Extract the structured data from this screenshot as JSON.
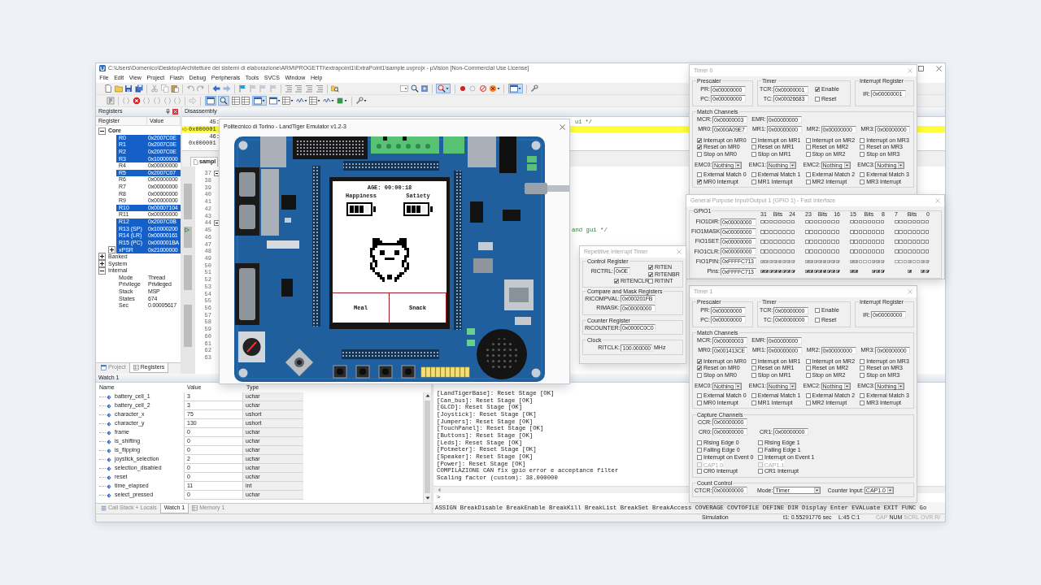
{
  "main_window": {
    "title": "C:\\Users\\Domenico\\Desktop\\Architetture dei sistemi di elaborazione\\ARM\\PROGETTI\\extrapoint1\\ExtraPoint1\\sample.uvprojx - µVision [Non-Commercial Use License]",
    "menu": [
      "File",
      "Edit",
      "View",
      "Project",
      "Flash",
      "Debug",
      "Peripherals",
      "Tools",
      "SVCS",
      "Window",
      "Help"
    ],
    "registers_panel": {
      "title": "Registers",
      "columns": [
        "Register",
        "Value"
      ],
      "tree": [
        {
          "name": "Core",
          "emphasized": true,
          "expanded": true,
          "children": [
            {
              "kind": "register",
              "name": "R0",
              "value": "0x2007C0E",
              "highlighted": true
            },
            {
              "kind": "register",
              "name": "R1",
              "value": "0x2007C0E",
              "highlighted": true
            },
            {
              "kind": "register",
              "name": "R2",
              "value": "0x2007C0E",
              "highlighted": true
            },
            {
              "kind": "register",
              "name": "R3",
              "value": "0x10000000",
              "highlighted": true
            },
            {
              "kind": "register",
              "name": "R4",
              "value": "0x00000000",
              "highlighted": false
            },
            {
              "kind": "register",
              "name": "R5",
              "value": "0x2007C07",
              "highlighted": true
            },
            {
              "kind": "register",
              "name": "R6",
              "value": "0x00000000",
              "highlighted": false
            },
            {
              "kind": "register",
              "name": "R7",
              "value": "0x00000000",
              "highlighted": false
            },
            {
              "kind": "register",
              "name": "R8",
              "value": "0x00000000",
              "highlighted": false
            },
            {
              "kind": "register",
              "name": "R9",
              "value": "0x00000000",
              "highlighted": false
            },
            {
              "kind": "register",
              "name": "R10",
              "value": "0x00007104",
              "highlighted": true
            },
            {
              "kind": "register",
              "name": "R11",
              "value": "0x00000000",
              "highlighted": false
            },
            {
              "kind": "register",
              "name": "R12",
              "value": "0x2007C0B",
              "highlighted": true
            },
            {
              "kind": "register",
              "name": "R13 (SP)",
              "value": "0x10000200",
              "highlighted": true
            },
            {
              "kind": "register",
              "name": "R14 (LR)",
              "value": "0x00000161",
              "highlighted": true
            },
            {
              "kind": "register",
              "name": "R15 (PC)",
              "value": "0x000001BA",
              "highlighted": true
            },
            {
              "kind": "group",
              "name": "xPSR",
              "value": "0x21000000",
              "highlighted": true,
              "expanded": false
            }
          ]
        },
        {
          "name": "Banked",
          "emphasized": false,
          "expanded": false
        },
        {
          "name": "System",
          "emphasized": false,
          "expanded": false
        },
        {
          "name": "Internal",
          "emphasized": false,
          "expanded": true,
          "children": [
            {
              "kind": "register",
              "name": "Mode",
              "value": "Thread",
              "highlighted": false
            },
            {
              "kind": "register",
              "name": "Privilege",
              "value": "Privileged",
              "highlighted": false
            },
            {
              "kind": "register",
              "name": "Stack",
              "value": "MSP",
              "highlighted": false
            },
            {
              "kind": "register",
              "name": "States",
              "value": "674",
              "highlighted": false
            },
            {
              "kind": "register",
              "name": "Sec",
              "value": "0.00005617",
              "highlighted": false
            }
          ]
        }
      ],
      "tabs": [
        {
          "label": "Project",
          "selected": false
        },
        {
          "label": "Registers",
          "selected": true
        }
      ]
    },
    "disassembly": {
      "title": "Disassembly",
      "lines": [
        {
          "kind": "source",
          "text": "45:",
          "tail": "ui */",
          "current": false
        },
        {
          "kind": "address",
          "text": "0x000001",
          "current": true
        },
        {
          "kind": "source",
          "text": "46:",
          "current": false
        },
        {
          "kind": "address",
          "text": "0x000001",
          "current": false
        }
      ]
    },
    "editor": {
      "tab": "sampl",
      "lines": [
        {
          "number": "37",
          "executable": false,
          "fold_marker": true,
          "current": false
        },
        {
          "number": "38",
          "executable": false,
          "fold_marker": false,
          "current": false
        },
        {
          "number": "39",
          "executable": true,
          "fold_marker": false,
          "current": false
        },
        {
          "number": "40",
          "executable": true,
          "fold_marker": false,
          "current": false
        },
        {
          "number": "41",
          "executable": true,
          "fold_marker": false,
          "current": false
        },
        {
          "number": "42",
          "executable": true,
          "fold_marker": false,
          "current": false
        },
        {
          "number": "43",
          "executable": true,
          "fold_marker": false,
          "current": false
        },
        {
          "number": "44",
          "executable": false,
          "fold_marker": true,
          "current": false
        },
        {
          "number": "45",
          "executable": true,
          "fold_marker": false,
          "current": true,
          "text": "and gui */"
        },
        {
          "number": "46",
          "executable": true,
          "fold_marker": false,
          "current": false
        },
        {
          "number": "47",
          "executable": true,
          "fold_marker": false,
          "current": false
        },
        {
          "number": "48",
          "executable": false,
          "fold_marker": false,
          "current": false
        },
        {
          "number": "49",
          "executable": true,
          "fold_marker": false,
          "current": false
        },
        {
          "number": "50",
          "executable": true,
          "fold_marker": false,
          "current": false
        },
        {
          "number": "51",
          "executable": true,
          "fold_marker": false,
          "current": false
        },
        {
          "number": "52",
          "executable": true,
          "fold_marker": false,
          "current": false
        },
        {
          "number": "53",
          "executable": true,
          "fold_marker": false,
          "current": false
        },
        {
          "number": "54",
          "executable": false,
          "fold_marker": false,
          "current": false
        },
        {
          "number": "55",
          "executable": false,
          "fold_marker": false,
          "current": false
        },
        {
          "number": "56",
          "executable": true,
          "fold_marker": false,
          "current": false
        },
        {
          "number": "57",
          "executable": true,
          "fold_marker": false,
          "current": false
        },
        {
          "number": "58",
          "executable": true,
          "fold_marker": false,
          "current": false
        },
        {
          "number": "59",
          "executable": true,
          "fold_marker": false,
          "current": false
        },
        {
          "number": "60",
          "executable": true,
          "fold_marker": false,
          "current": false
        },
        {
          "number": "61",
          "executable": true,
          "fold_marker": false,
          "current": false
        },
        {
          "number": "62",
          "executable": false,
          "fold_marker": false,
          "current": false
        },
        {
          "number": "63",
          "executable": false,
          "fold_marker": false,
          "current": false
        }
      ]
    },
    "watch_panel": {
      "title": "Watch 1",
      "columns": [
        "Name",
        "Value",
        "Type"
      ],
      "rows": [
        {
          "name": "battery_cell_1",
          "value": "3",
          "type": "uchar"
        },
        {
          "name": "battery_cell_2",
          "value": "3",
          "type": "uchar"
        },
        {
          "name": "character_x",
          "value": "75",
          "type": "ushort"
        },
        {
          "name": "character_y",
          "value": "130",
          "type": "ushort"
        },
        {
          "name": "frame",
          "value": "0",
          "type": "uchar"
        },
        {
          "name": "is_shifting",
          "value": "0",
          "type": "uchar"
        },
        {
          "name": "is_flipping",
          "value": "0",
          "type": "uchar"
        },
        {
          "name": "joystick_selection",
          "value": "2",
          "type": "uchar"
        },
        {
          "name": "selection_disabled",
          "value": "0",
          "type": "uchar"
        },
        {
          "name": "reset",
          "value": "0",
          "type": "uchar"
        },
        {
          "name": "time_elapsed",
          "value": "11",
          "type": "int"
        },
        {
          "name": "select_pressed",
          "value": "0",
          "type": "uchar"
        }
      ],
      "tabs": [
        {
          "label": "Call Stack + Locals",
          "selected": false
        },
        {
          "label": "Watch 1",
          "selected": true
        },
        {
          "label": "Memory 1",
          "selected": false
        }
      ]
    },
    "command_panel": {
      "lines": [
        "[LandTigerBase]: Reset Stage [OK]",
        "[Can_bus]: Reset Stage [OK]",
        "[GLCD]: Reset Stage [OK]",
        "[Joystick]: Reset Stage [OK]",
        "[Jumpers]: Reset Stage [OK]",
        "[TouchPanel]: Reset Stage [OK]",
        "[Buttons]: Reset Stage [OK]",
        "[Leds]: Reset Stage [OK]",
        "[Potmeter]: Reset Stage [OK]",
        "[Speaker]: Reset Stage [OK]",
        "[Power]: Reset Stage [OK]",
        "COMPILAZIONE CAN fix gpio error e acceptance filter",
        "Scaling factor (custom): 38.000000"
      ],
      "prompt": ">",
      "help": "ASSIGN BreakDisable BreakEnable BreakKill BreakList BreakSet BreakAccess COVERAGE COVTOFILE DEFINE DIR Display Enter EVALuate EXIT FUNC Go"
    },
    "status_bar": {
      "mode": "Simulation",
      "time": "t1: 0.55291776 sec",
      "position": "L:45 C:1",
      "indicators": [
        {
          "label": "CAP",
          "on": false
        },
        {
          "label": "NUM",
          "on": true
        },
        {
          "label": "SCRL",
          "on": false
        },
        {
          "label": "OVR",
          "on": false
        },
        {
          "label": "R/",
          "on": false
        }
      ]
    }
  },
  "emulator_window": {
    "title": "Politecnico di Torino - LandTiger Emulator v1.2-3",
    "active": true,
    "lcd": {
      "age": "AGE: 00:00:18",
      "meters": [
        {
          "label": "Happiness",
          "level": 0.75
        },
        {
          "label": "Satiety",
          "level": 0.75
        }
      ],
      "buttons": [
        "Meal",
        "Snack"
      ]
    }
  },
  "rit_window": {
    "title": "Repetitive Interrupt Timer",
    "active": false,
    "control": {
      "label": "Control Register",
      "field": {
        "label": "RICTRL:",
        "value": "0x0E"
      },
      "checks": [
        {
          "label": "RITEN",
          "checked": true
        },
        {
          "label": "RITENBR",
          "checked": true
        },
        {
          "label": "RITENCLR",
          "checked": true
        },
        {
          "label": "RITINT",
          "checked": false
        }
      ]
    },
    "groups": [
      {
        "label": "Compare and Mask Registers",
        "fields": [
          {
            "label": "RICOMPVAL:",
            "value": "0x000201FB"
          },
          {
            "label": "RIMASK:",
            "value": "0x00000000"
          }
        ]
      },
      {
        "label": "Counter Register",
        "fields": [
          {
            "label": "RICOUNTER:",
            "value": "0x0000C0C0"
          }
        ]
      },
      {
        "label": "Clock",
        "fields": [
          {
            "label": "RITCLK:",
            "value": "100.000000",
            "unit": "MHz"
          }
        ]
      }
    ]
  },
  "timer_0_window": {
    "title": "Timer 0",
    "active": false,
    "prescaler": {
      "label": "Prescaler",
      "fields": [
        {
          "label": "PR:",
          "value": "0x00000000"
        },
        {
          "label": "PC:",
          "value": "0x00000000"
        }
      ]
    },
    "timer": {
      "label": "Timer",
      "fields": [
        {
          "label": "TCR:",
          "value": "0x00000001",
          "option": {
            "label": "Enable",
            "checked": true
          }
        },
        {
          "label": "TC:",
          "value": "0x00026683",
          "option": {
            "label": "Reset",
            "checked": false
          }
        }
      ]
    },
    "interrupt": {
      "label": "Interrupt Register",
      "fields": [
        {
          "label": "IR:",
          "value": "0x00000001"
        }
      ]
    },
    "match": {
      "label": "Match Channels",
      "fields": [
        {
          "label": "MCR:",
          "value": "0x00000003"
        },
        {
          "label": "EMR:",
          "value": "0x00000000"
        }
      ],
      "channels": [
        {
          "register": {
            "label": "MR0:",
            "value": "0x000A09E7"
          },
          "options": [
            {
              "label": "Interrupt on MR0",
              "checked": true
            },
            {
              "label": "Reset on MR0",
              "checked": true
            },
            {
              "label": "Stop on MR0",
              "checked": false
            }
          ],
          "emc": {
            "label": "EMC0:",
            "value": "Nothing"
          },
          "outputs": [
            {
              "label": "External Match 0",
              "checked": false
            },
            {
              "label": "MR0 Interrupt",
              "checked": true
            }
          ]
        },
        {
          "register": {
            "label": "MR1:",
            "value": "0x00000000"
          },
          "options": [
            {
              "label": "Interrupt on MR1",
              "checked": false
            },
            {
              "label": "Reset on MR1",
              "checked": false
            },
            {
              "label": "Stop on MR1",
              "checked": false
            }
          ],
          "emc": {
            "label": "EMC1:",
            "value": "Nothing"
          },
          "outputs": [
            {
              "label": "External Match 1",
              "checked": false
            },
            {
              "label": "MR1 Interrupt",
              "checked": false
            }
          ]
        },
        {
          "register": {
            "label": "MR2:",
            "value": "0x00000000"
          },
          "options": [
            {
              "label": "Interrupt on MR2",
              "checked": false
            },
            {
              "label": "Reset on MR2",
              "checked": false
            },
            {
              "label": "Stop on MR2",
              "checked": false
            }
          ],
          "emc": {
            "label": "EMC2:",
            "value": "Nothing"
          },
          "outputs": [
            {
              "label": "External Match 2",
              "checked": false
            },
            {
              "label": "MR2 Interrupt",
              "checked": false
            }
          ]
        },
        {
          "register": {
            "label": "MR3:",
            "value": "0x00000000"
          },
          "options": [
            {
              "label": "Interrupt on MR3",
              "checked": false
            },
            {
              "label": "Reset on MR3",
              "checked": false
            },
            {
              "label": "Stop on MR3",
              "checked": false
            }
          ],
          "emc": {
            "label": "EMC3:",
            "value": "Nothing"
          },
          "outputs": [
            {
              "label": "External Match 3",
              "checked": false
            },
            {
              "label": "MR3 Interrupt",
              "checked": false
            }
          ]
        }
      ]
    }
  },
  "gpio_window": {
    "title": "General Purpose Input/Output 1 (GPIO 1) - Fast Interface",
    "active": false,
    "group": "GPIO1",
    "bit_groups": [
      {
        "high": "31",
        "label": "Bits",
        "low": "24"
      },
      {
        "high": "23",
        "label": "Bits",
        "low": "16"
      },
      {
        "high": "15",
        "label": "Bits",
        "low": "8"
      },
      {
        "high": "7",
        "label": "Bits",
        "low": "0"
      }
    ],
    "rows": [
      {
        "kind": "register",
        "label": "FIO1DIR:",
        "value": "0x00000000",
        "bits": [
          false,
          false,
          false,
          false,
          false,
          false,
          false,
          false,
          false,
          false,
          false,
          false,
          false,
          false,
          false,
          false,
          false,
          false,
          false,
          false,
          false,
          false,
          false,
          false,
          false,
          false,
          false,
          false,
          false,
          false,
          false,
          false
        ]
      },
      {
        "kind": "register",
        "label": "FIO1MASK:",
        "value": "0x00000000",
        "bits": [
          false,
          false,
          false,
          false,
          false,
          false,
          false,
          false,
          false,
          false,
          false,
          false,
          false,
          false,
          false,
          false,
          false,
          false,
          false,
          false,
          false,
          false,
          false,
          false,
          false,
          false,
          false,
          false,
          false,
          false,
          false,
          false
        ]
      },
      {
        "kind": "register",
        "label": "FIO1SET:",
        "value": "0x00000000",
        "bits": [
          false,
          false,
          false,
          false,
          false,
          false,
          false,
          false,
          false,
          false,
          false,
          false,
          false,
          false,
          false,
          false,
          false,
          false,
          false,
          false,
          false,
          false,
          false,
          false,
          false,
          false,
          false,
          false,
          false,
          false,
          false,
          false
        ]
      },
      {
        "kind": "register",
        "label": "FIO1CLR:",
        "value": "0x00000000",
        "bits": [
          false,
          false,
          false,
          false,
          false,
          false,
          false,
          false,
          false,
          false,
          false,
          false,
          false,
          false,
          false,
          false,
          false,
          false,
          false,
          false,
          false,
          false,
          false,
          false,
          false,
          false,
          false,
          false,
          false,
          false,
          false,
          false
        ]
      },
      {
        "kind": "readonly",
        "label": "FIO1PIN:",
        "value": "0xFFFFC713",
        "bits": [
          true,
          true,
          true,
          true,
          true,
          true,
          true,
          true,
          true,
          true,
          true,
          true,
          true,
          true,
          true,
          true,
          true,
          true,
          false,
          false,
          false,
          true,
          true,
          true,
          false,
          false,
          false,
          true,
          false,
          false,
          true,
          true
        ]
      },
      {
        "kind": "pins",
        "label": "Pins:",
        "value": "0xFFFFC713",
        "bits": [
          true,
          true,
          true,
          true,
          true,
          true,
          true,
          true,
          true,
          true,
          true,
          true,
          true,
          true,
          true,
          true,
          true,
          true,
          false,
          false,
          false,
          true,
          true,
          true,
          false,
          false,
          false,
          true,
          false,
          false,
          true,
          true
        ]
      }
    ]
  },
  "timer_1_window": {
    "title": "Timer 1",
    "active": false,
    "prescaler": {
      "label": "Prescaler",
      "fields": [
        {
          "label": "PR:",
          "value": "0x00000000"
        },
        {
          "label": "PC:",
          "value": "0x00000000"
        }
      ]
    },
    "timer": {
      "label": "Timer",
      "fields": [
        {
          "label": "TCR:",
          "value": "0x00000000",
          "option": {
            "label": "Enable",
            "checked": false
          }
        },
        {
          "label": "TC:",
          "value": "0x00000000",
          "option": {
            "label": "Reset",
            "checked": false
          }
        }
      ]
    },
    "interrupt": {
      "label": "Interrupt Register",
      "fields": [
        {
          "label": "IR:",
          "value": "0x00000000"
        }
      ]
    },
    "match": {
      "label": "Match Channels",
      "fields": [
        {
          "label": "MCR:",
          "value": "0x00000003"
        },
        {
          "label": "EMR:",
          "value": "0x00000000"
        }
      ],
      "channels": [
        {
          "register": {
            "label": "MR0:",
            "value": "0x001413CE"
          },
          "options": [
            {
              "label": "Interrupt on MR0",
              "checked": true
            },
            {
              "label": "Reset on MR0",
              "checked": true
            },
            {
              "label": "Stop on MR0",
              "checked": false
            }
          ],
          "emc": {
            "label": "EMC0:",
            "value": "Nothing"
          },
          "outputs": [
            {
              "label": "External Match 0",
              "checked": false
            },
            {
              "label": "MR0 Interrupt",
              "checked": false
            }
          ]
        },
        {
          "register": {
            "label": "MR1:",
            "value": "0x00000000"
          },
          "options": [
            {
              "label": "Interrupt on MR1",
              "checked": false
            },
            {
              "label": "Reset on MR1",
              "checked": false
            },
            {
              "label": "Stop on MR1",
              "checked": false
            }
          ],
          "emc": {
            "label": "EMC1:",
            "value": "Nothing"
          },
          "outputs": [
            {
              "label": "External Match 1",
              "checked": false
            },
            {
              "label": "MR1 Interrupt",
              "checked": false
            }
          ]
        },
        {
          "register": {
            "label": "MR2:",
            "value": "0x00000000"
          },
          "options": [
            {
              "label": "Interrupt on MR2",
              "checked": false
            },
            {
              "label": "Reset on MR2",
              "checked": false
            },
            {
              "label": "Stop on MR2",
              "checked": false
            }
          ],
          "emc": {
            "label": "EMC2:",
            "value": "Nothing"
          },
          "outputs": [
            {
              "label": "External Match 2",
              "checked": false
            },
            {
              "label": "MR2 Interrupt",
              "checked": false
            }
          ]
        },
        {
          "register": {
            "label": "MR3:",
            "value": "0x00000000"
          },
          "options": [
            {
              "label": "Interrupt on MR3",
              "checked": false
            },
            {
              "label": "Reset on MR3",
              "checked": false
            },
            {
              "label": "Stop on MR3",
              "checked": false
            }
          ],
          "emc": {
            "label": "EMC3:",
            "value": "Nothing"
          },
          "outputs": [
            {
              "label": "External Match 3",
              "checked": false
            },
            {
              "label": "MR3 Interrupt",
              "checked": false
            }
          ]
        }
      ]
    },
    "capture": {
      "label": "Capture Channels",
      "fields": [
        {
          "label": "CCR:",
          "value": "0x00000000"
        }
      ],
      "channels": [
        {
          "register": {
            "label": "CR0:",
            "value": "0x00000000"
          },
          "options": [
            {
              "label": "Rising Edge 0",
              "checked": false,
              "disabled": false
            },
            {
              "label": "Falling Edge 0",
              "checked": false,
              "disabled": false
            },
            {
              "label": "Interrupt on Event 0",
              "checked": false,
              "disabled": false
            },
            {
              "label": "CAP1.0",
              "checked": false,
              "disabled": true
            },
            {
              "label": "CR0 Interrupt",
              "checked": false,
              "disabled": false
            }
          ]
        },
        {
          "register": {
            "label": "CR1:",
            "value": "0x00000000"
          },
          "options": [
            {
              "label": "Rising Edge 1",
              "checked": false,
              "disabled": false
            },
            {
              "label": "Falling Edge 1",
              "checked": false,
              "disabled": false
            },
            {
              "label": "Interrupt on Event 1",
              "checked": false,
              "disabled": false
            },
            {
              "label": "CAP1.1",
              "checked": false,
              "disabled": true
            },
            {
              "label": "CR1 Interrupt",
              "checked": false,
              "disabled": false
            }
          ]
        }
      ]
    },
    "count_control": {
      "label": "Count Control",
      "fields": [
        {
          "kind": "field",
          "label": "CTCR:",
          "value": "0x00000000"
        },
        {
          "kind": "dropdown",
          "label": "Mode:",
          "value": "Timer"
        },
        {
          "kind": "dropdown",
          "label": "Counter Input:",
          "value": "CAP1.0"
        }
      ]
    }
  }
}
